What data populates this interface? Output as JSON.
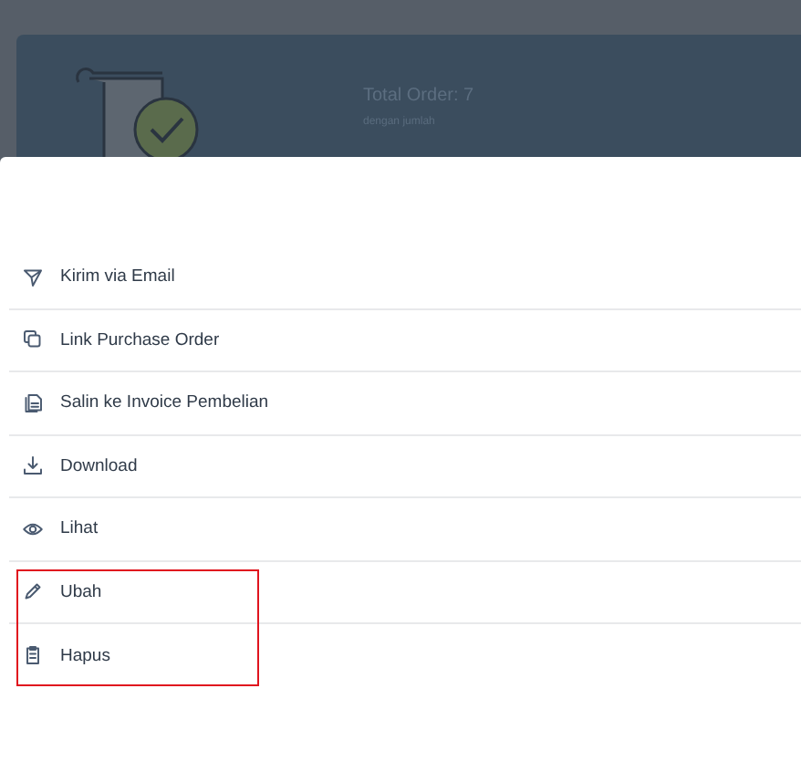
{
  "background_card": {
    "title": "Total Order: 7",
    "subtitle": "dengan jumlah"
  },
  "menu": [
    {
      "kind": "send",
      "label": "Kirim via Email",
      "highlighted": false
    },
    {
      "kind": "link",
      "label": "Link Purchase Order",
      "highlighted": false
    },
    {
      "kind": "copy",
      "label": "Salin ke Invoice Pembelian",
      "highlighted": false
    },
    {
      "kind": "download",
      "label": "Download",
      "highlighted": false
    },
    {
      "kind": "view",
      "label": "Lihat",
      "highlighted": false
    },
    {
      "kind": "edit",
      "label": "Ubah",
      "highlighted": true
    },
    {
      "kind": "delete",
      "label": "Hapus",
      "highlighted": true
    }
  ]
}
